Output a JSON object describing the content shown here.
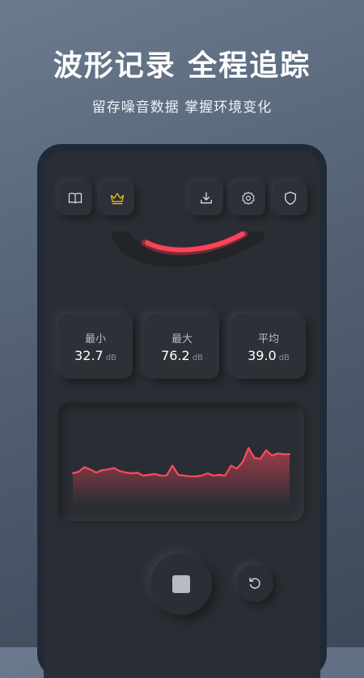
{
  "promo": {
    "headline": "波形记录 全程追踪",
    "subline": "留存噪音数据 掌握环境变化"
  },
  "toolbar": {
    "icons": [
      "book-icon",
      "crown-icon",
      "download-icon",
      "gear-icon",
      "shield-icon"
    ],
    "accent": "#e5b41c"
  },
  "stats": {
    "min": {
      "label": "最小",
      "value": "32.7",
      "unit": "dB"
    },
    "max": {
      "label": "最大",
      "value": "76.2",
      "unit": "dB"
    },
    "avg": {
      "label": "平均",
      "value": "39.0",
      "unit": "dB"
    }
  },
  "waveform": {
    "color": "#ff4a5c",
    "levels": [
      40,
      42,
      48,
      45,
      41,
      44,
      45,
      47,
      43,
      41,
      40,
      41,
      37,
      38,
      39,
      37,
      37,
      50,
      38,
      37,
      36,
      36,
      37,
      40,
      37,
      38,
      37,
      50,
      46,
      55,
      73,
      60,
      59,
      70,
      63,
      66,
      65,
      65
    ]
  },
  "controls": {
    "stop": "stop-icon",
    "reset": "reset-icon"
  }
}
